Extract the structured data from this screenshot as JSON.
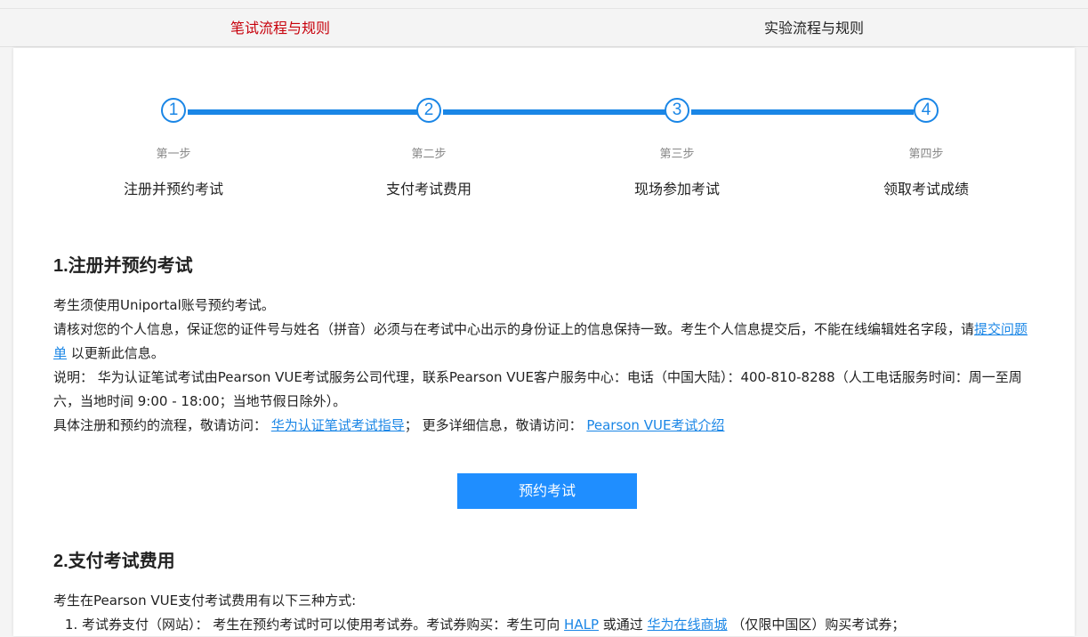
{
  "tabs": [
    {
      "label": "笔试流程与规则",
      "active": true
    },
    {
      "label": "实验流程与规则",
      "active": false
    }
  ],
  "steps": [
    {
      "number": "1",
      "caption": "第一步",
      "title": "注册并预约考试"
    },
    {
      "number": "2",
      "caption": "第二步",
      "title": "支付考试费用"
    },
    {
      "number": "3",
      "caption": "第三步",
      "title": "现场参加考试"
    },
    {
      "number": "4",
      "caption": "第四步",
      "title": "领取考试成绩"
    }
  ],
  "section1": {
    "heading": "1.注册并预约考试",
    "line1": "考生须使用Uniportal账号预约考试。",
    "line2_pre": "请核对您的个人信息，保证您的证件号与姓名（拼音）必须与在考试中心出示的身份证上的信息保持一致。考生个人信息提交后，不能在线编辑姓名字段，请",
    "line2_link": "提交问题单",
    "line2_post": " 以更新此信息。",
    "line3": "说明： 华为认证笔试考试由Pearson VUE考试服务公司代理，联系Pearson VUE客户服务中心：电话（中国大陆）：400-810-8288（人工电话服务时间：周一至周六，当地时间 9:00 - 18:00；当地节假日除外）。",
    "line4_pre": "具体注册和预约的流程，敬请访问： ",
    "line4_link1": "华为认证笔试考试指导",
    "line4_mid": "； 更多详细信息，敬请访问： ",
    "line4_link2": "Pearson VUE考试介绍",
    "button": "预约考试"
  },
  "section2": {
    "heading": "2.支付考试费用",
    "intro": "考生在Pearson VUE支付考试费用有以下三种方式:",
    "item1_pre": "考试券支付（网站）： 考生在预约考试时可以使用考试券。考试券购买：考生可向 ",
    "item1_link1": "HALP",
    "item1_mid": " 或通过 ",
    "item1_link2": "华为在线商城",
    "item1_post": " （仅限中国区）购买考试券；"
  },
  "colors": {
    "accent": "#1a86e6",
    "active_tab": "#c7000b",
    "button": "#1f8eff"
  }
}
